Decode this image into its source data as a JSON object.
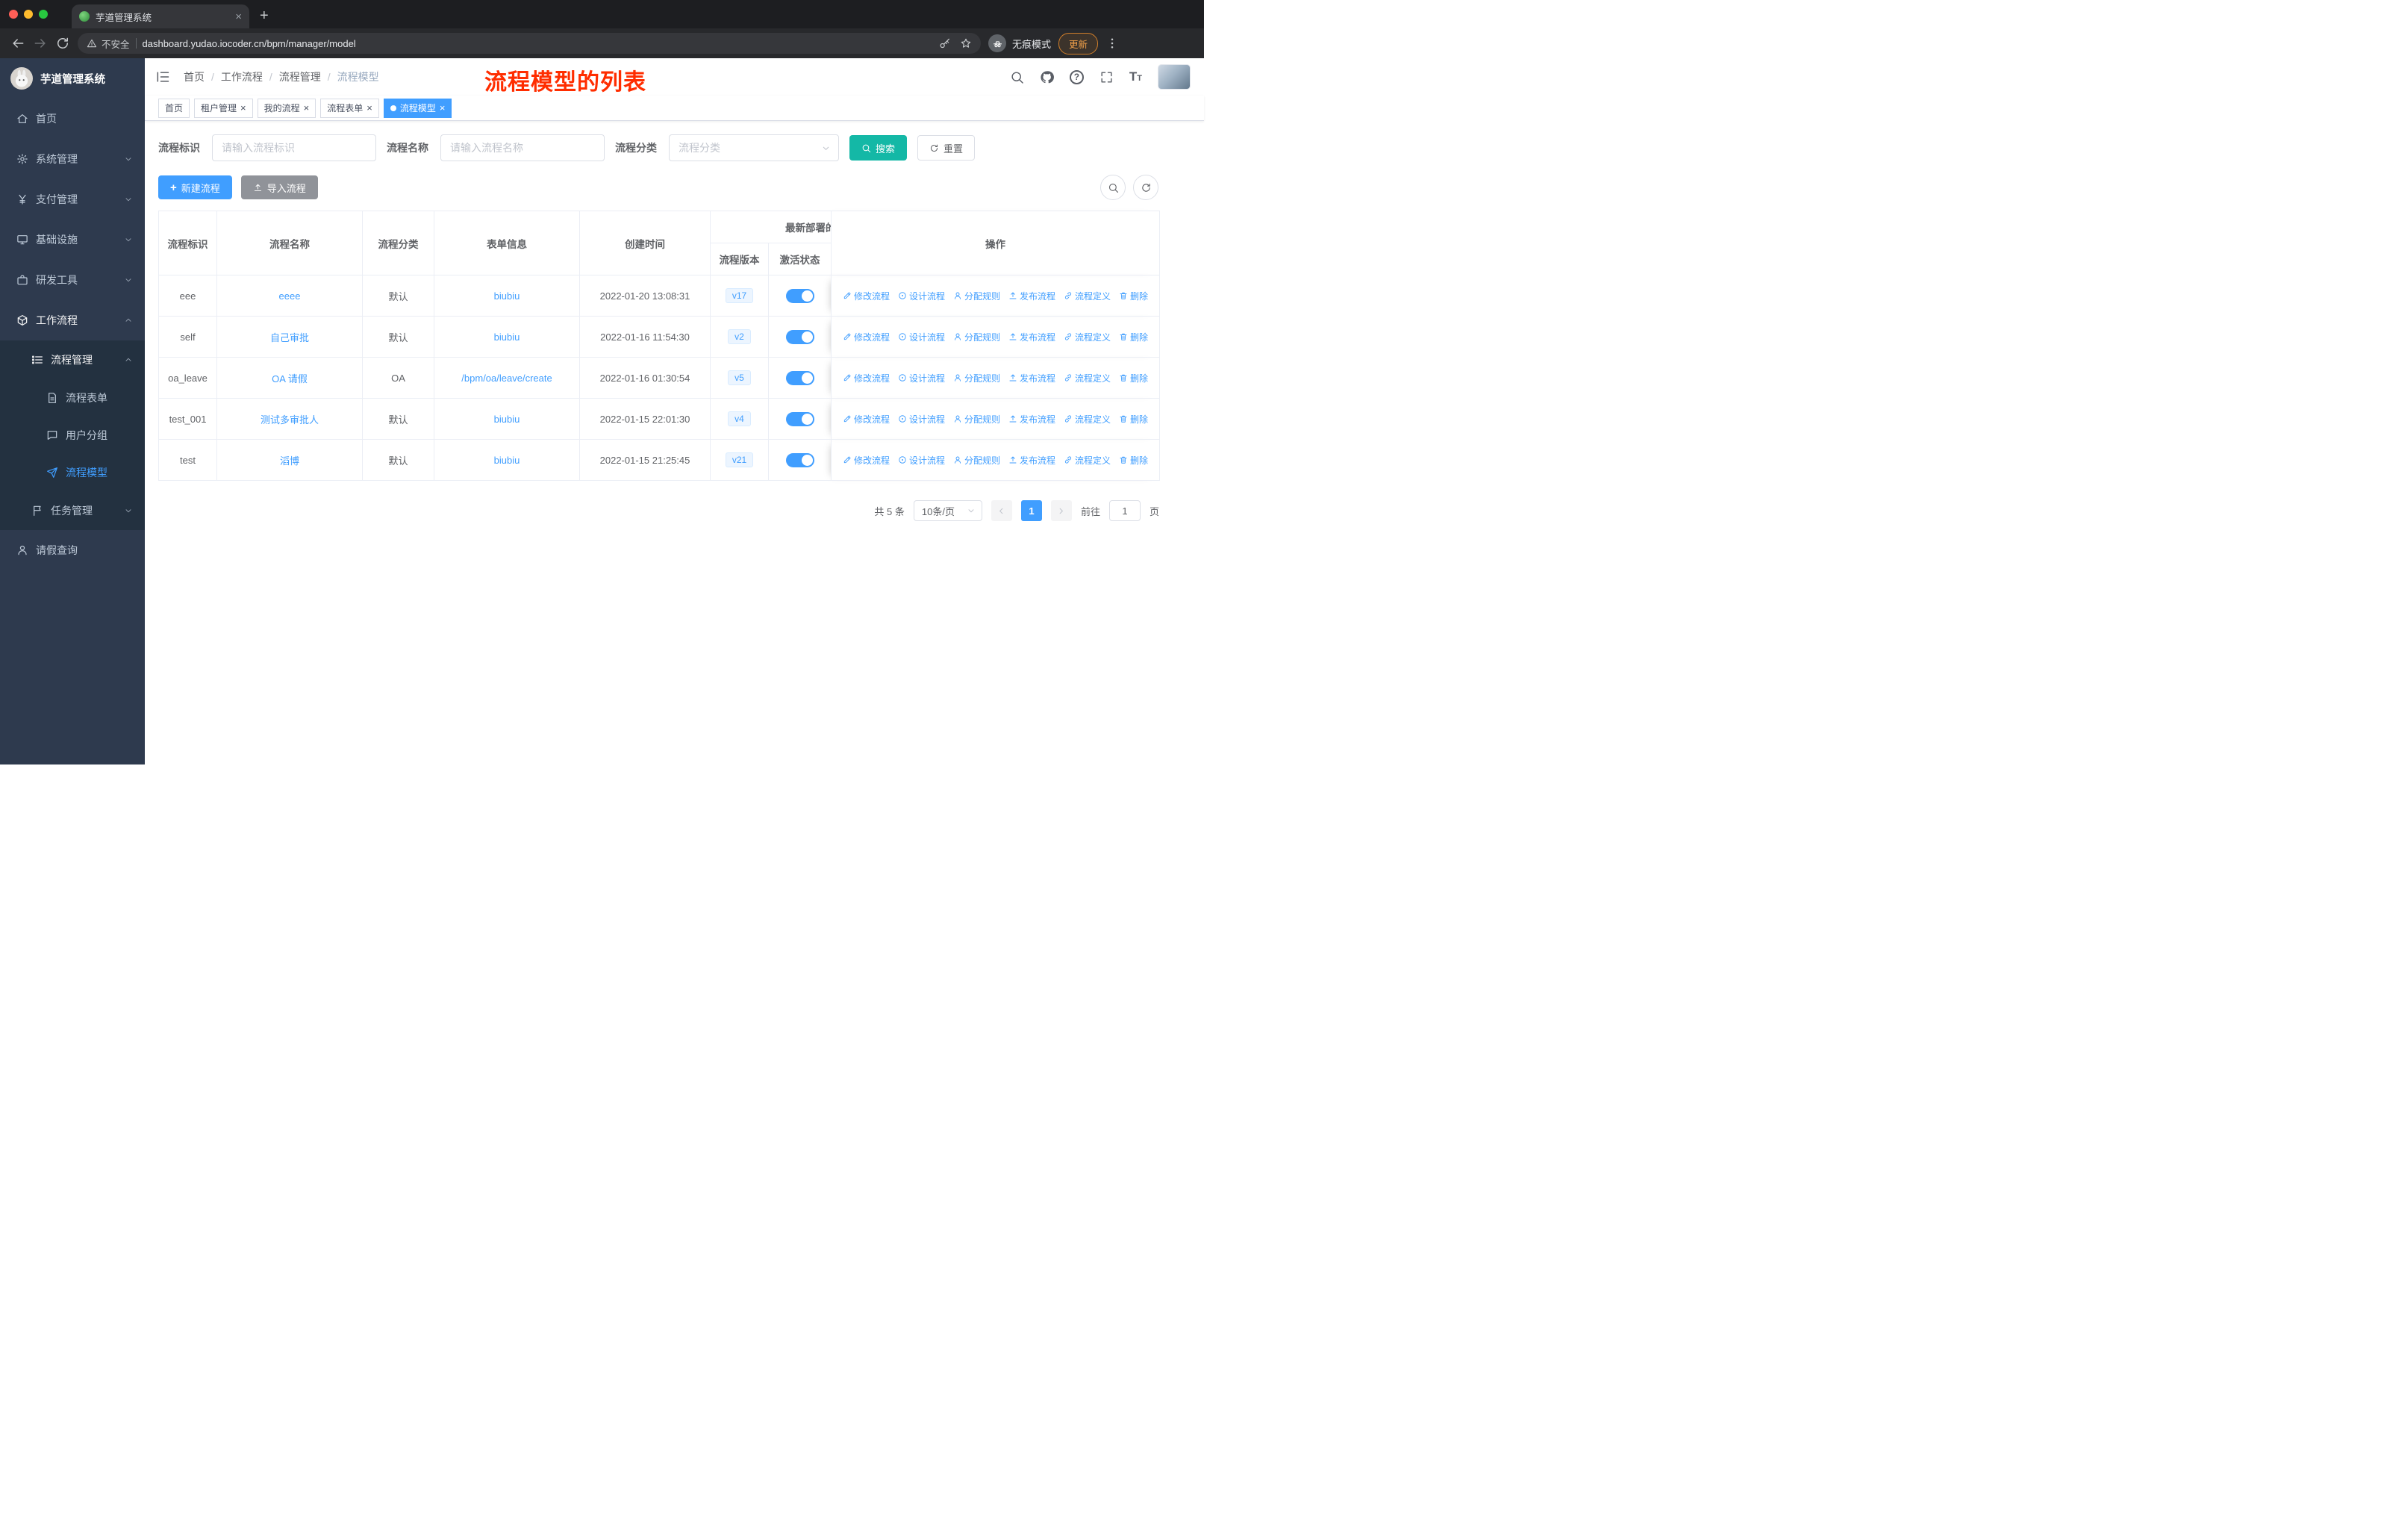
{
  "browser": {
    "tab_title": "芋道管理系统",
    "security_label": "不安全",
    "url": "dashboard.yudao.iocoder.cn/bpm/manager/model",
    "incognito_label": "无痕模式",
    "update_label": "更新"
  },
  "sidebar": {
    "logo_title": "芋道管理系统",
    "items": [
      {
        "key": "home",
        "label": "首页",
        "icon": "home",
        "level": 1
      },
      {
        "key": "system-mgmt",
        "label": "系统管理",
        "icon": "gear",
        "level": 1,
        "chevron": "down"
      },
      {
        "key": "payment-mgmt",
        "label": "支付管理",
        "icon": "yen",
        "level": 1,
        "chevron": "down"
      },
      {
        "key": "infrastructure",
        "label": "基础设施",
        "icon": "infra",
        "level": 1,
        "chevron": "down"
      },
      {
        "key": "dev-tools",
        "label": "研发工具",
        "icon": "tools",
        "level": 1,
        "chevron": "down"
      },
      {
        "key": "workflow",
        "label": "工作流程",
        "icon": "work",
        "level": 1,
        "chevron": "up",
        "open": true
      },
      {
        "key": "process-mgmt",
        "label": "流程管理",
        "icon": "mgmt",
        "level": 2,
        "chevron": "up",
        "open": true,
        "dark": true
      },
      {
        "key": "process-form",
        "label": "流程表单",
        "icon": "form",
        "level": 3,
        "dark": true
      },
      {
        "key": "user-group",
        "label": "用户分组",
        "icon": "chat",
        "level": 3,
        "dark": true
      },
      {
        "key": "process-model",
        "label": "流程模型",
        "icon": "plane",
        "level": 3,
        "dark": true,
        "active": true
      },
      {
        "key": "task-mgmt",
        "label": "任务管理",
        "icon": "flag",
        "level": 2,
        "chevron": "down",
        "dark": true
      },
      {
        "key": "leave-query",
        "label": "请假查询",
        "icon": "user",
        "level": 1
      }
    ]
  },
  "header": {
    "breadcrumb": [
      "首页",
      "工作流程",
      "流程管理",
      "流程模型"
    ],
    "annotation": "流程模型的列表"
  },
  "tabs": [
    {
      "label": "首页",
      "closable": false,
      "active": false
    },
    {
      "label": "租户管理",
      "closable": true,
      "active": false
    },
    {
      "label": "我的流程",
      "closable": true,
      "active": false
    },
    {
      "label": "流程表单",
      "closable": true,
      "active": false
    },
    {
      "label": "流程模型",
      "closable": true,
      "active": true
    }
  ],
  "filters": {
    "key": {
      "label": "流程标识",
      "placeholder": "请输入流程标识"
    },
    "name": {
      "label": "流程名称",
      "placeholder": "请输入流程名称"
    },
    "category": {
      "label": "流程分类",
      "placeholder": "流程分类"
    },
    "search_label": "搜索",
    "reset_label": "重置"
  },
  "toolbar": {
    "new_label": "新建流程",
    "import_label": "导入流程"
  },
  "table": {
    "headers": {
      "id": "流程标识",
      "name": "流程名称",
      "category": "流程分类",
      "form": "表单信息",
      "created": "创建时间",
      "deploy_group": "最新部署的",
      "version": "流程版本",
      "status": "激活状态",
      "ops": "操作"
    },
    "actions": [
      {
        "icon": "edit",
        "label": "修改流程"
      },
      {
        "icon": "design",
        "label": "设计流程"
      },
      {
        "icon": "assign",
        "label": "分配规则"
      },
      {
        "icon": "publish",
        "label": "发布流程"
      },
      {
        "icon": "define",
        "label": "流程定义"
      },
      {
        "icon": "delete",
        "label": "删除"
      }
    ],
    "rows": [
      {
        "id": "eee",
        "name": "eeee",
        "category": "默认",
        "form": "biubiu",
        "created": "2022-01-20 13:08:31",
        "version": "v17",
        "active": true
      },
      {
        "id": "self",
        "name": "自己审批",
        "category": "默认",
        "form": "biubiu",
        "created": "2022-01-16 11:54:30",
        "version": "v2",
        "active": true
      },
      {
        "id": "oa_leave",
        "name": "OA 请假",
        "category": "OA",
        "form": "/bpm/oa/leave/create",
        "created": "2022-01-16 01:30:54",
        "version": "v5",
        "active": true
      },
      {
        "id": "test_001",
        "name": "测试多审批人",
        "category": "默认",
        "form": "biubiu",
        "created": "2022-01-15 22:01:30",
        "version": "v4",
        "active": true
      },
      {
        "id": "test",
        "name": "滔博",
        "category": "默认",
        "form": "biubiu",
        "created": "2022-01-15 21:25:45",
        "version": "v21",
        "active": true
      }
    ]
  },
  "pagination": {
    "total": "共 5 条",
    "page_size": "10条/页",
    "current": "1",
    "goto_label": "前往",
    "goto_value": "1",
    "page_suffix": "页"
  },
  "colors": {
    "accent": "#409eff",
    "search_button": "#14b8a6",
    "annotation": "#ff2d00",
    "sidebar_bg": "#2e3a4e"
  }
}
